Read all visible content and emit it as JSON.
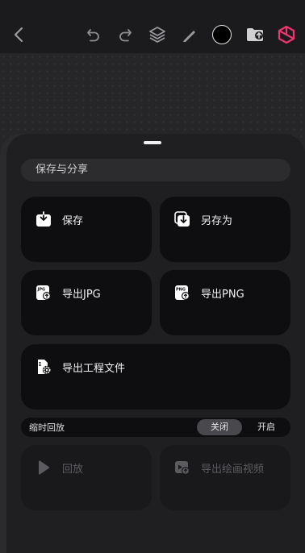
{
  "toolbar": {
    "icons": [
      "back-icon",
      "undo-icon",
      "redo-icon",
      "layers-icon",
      "brush-icon",
      "color-swatch",
      "import-folder-icon",
      "app-logo-icon"
    ],
    "brush_color": "#000000",
    "accent": "#f0346f"
  },
  "share_sheet": {
    "section_title": "保存与分享",
    "save_label": "保存",
    "save_as_label": "另存为",
    "export_jpg_label": "导出JPG",
    "jpg_badge": "JPG",
    "export_png_label": "导出PNG",
    "png_badge": "PNG",
    "export_project_label": "导出工程文件",
    "timelapse": {
      "label": "缩时回放",
      "off_label": "关闭",
      "on_label": "开启",
      "selected": "关闭"
    },
    "replay_label": "回放",
    "export_video_label": "导出绘画视频"
  }
}
